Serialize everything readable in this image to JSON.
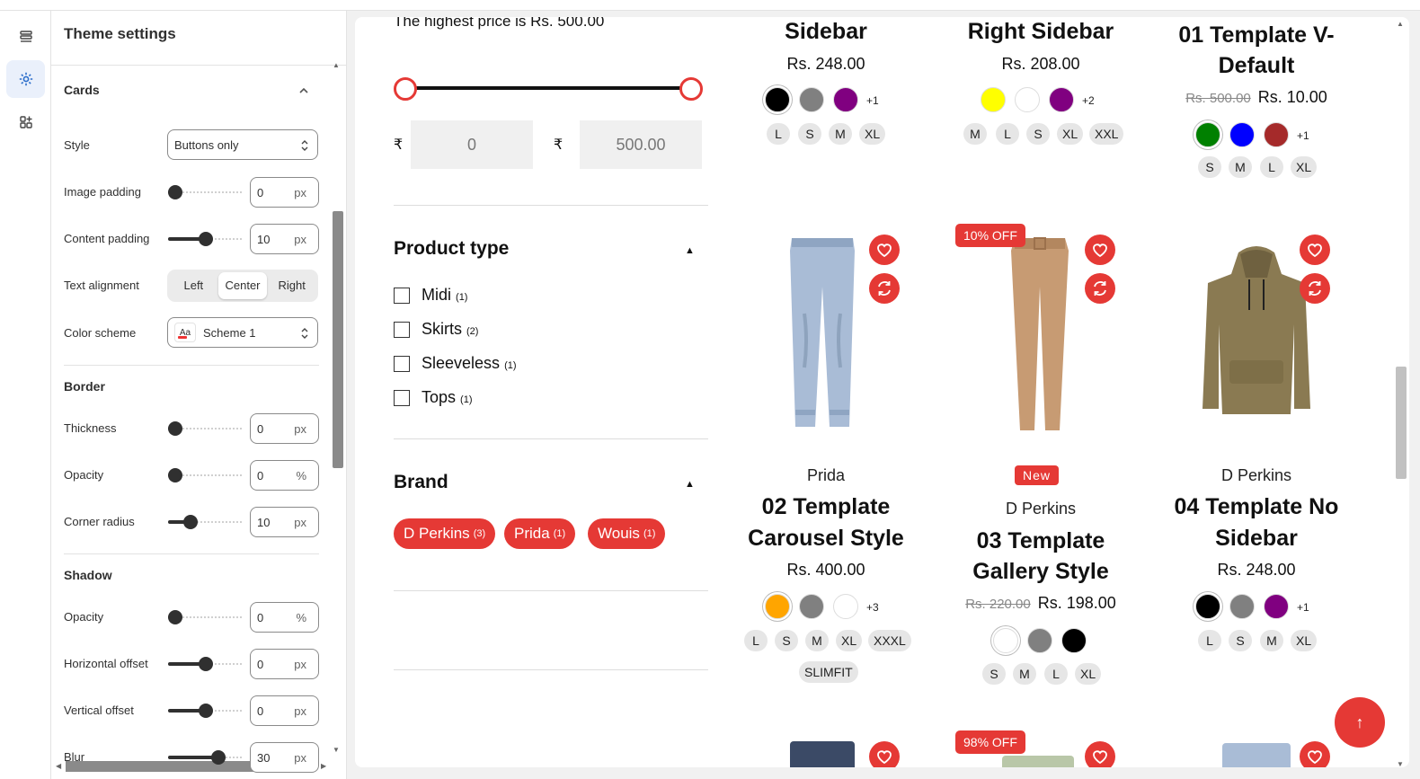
{
  "rail": {
    "icons": [
      "sections-icon",
      "gear-icon",
      "apps-icon"
    ]
  },
  "panel": {
    "title": "Theme settings",
    "cards": {
      "title": "Cards",
      "style_label": "Style",
      "style_value": "Buttons only",
      "image_padding_label": "Image padding",
      "image_padding_value": "0",
      "image_padding_unit": "px",
      "image_padding_level": 0,
      "content_padding_label": "Content padding",
      "content_padding_value": "10",
      "content_padding_unit": "px",
      "content_padding_level": 0.5,
      "text_alignment_label": "Text alignment",
      "align_options": [
        "Left",
        "Center",
        "Right"
      ],
      "align_selected": "Center",
      "color_scheme_label": "Color scheme",
      "color_scheme_swatch": "Aa",
      "color_scheme_value": "Scheme 1"
    },
    "border": {
      "title": "Border",
      "thickness_label": "Thickness",
      "thickness_value": "0",
      "thickness_unit": "px",
      "thickness_level": 0,
      "opacity_label": "Opacity",
      "opacity_value": "0",
      "opacity_unit": "%",
      "opacity_level": 0,
      "radius_label": "Corner radius",
      "radius_value": "10",
      "radius_unit": "px",
      "radius_level": 0.25
    },
    "shadow": {
      "title": "Shadow",
      "opacity_label": "Opacity",
      "opacity_value": "0",
      "opacity_unit": "%",
      "opacity_level": 0,
      "hoffset_label": "Horizontal offset",
      "hoffset_value": "0",
      "hoffset_unit": "px",
      "hoffset_level": 0.5,
      "voffset_label": "Vertical offset",
      "voffset_value": "0",
      "voffset_unit": "px",
      "voffset_level": 0.5,
      "blur_label": "Blur",
      "blur_value": "30",
      "blur_unit": "px",
      "blur_level": 0.7
    }
  },
  "filters": {
    "price_note": "The highest price is Rs. 500.00",
    "currency_symbol": "₹",
    "price_min": "0",
    "price_max": "500.00",
    "product_type": {
      "title": "Product type",
      "options": [
        {
          "label": "Midi",
          "count": "(1)"
        },
        {
          "label": "Skirts",
          "count": "(2)"
        },
        {
          "label": "Sleeveless",
          "count": "(1)"
        },
        {
          "label": "Tops",
          "count": "(1)"
        }
      ]
    },
    "brand": {
      "title": "Brand",
      "options": [
        {
          "label": "D Perkins",
          "count": "(3)"
        },
        {
          "label": "Prida",
          "count": "(1)"
        },
        {
          "label": "Wouis",
          "count": "(1)"
        }
      ]
    }
  },
  "products_top": [
    {
      "title": "Sidebar",
      "price": "Rs. 248.00",
      "colors": [
        "#000000",
        "#808080",
        "#800080"
      ],
      "more": "+1",
      "sizes": [
        "L",
        "S",
        "M",
        "XL"
      ]
    },
    {
      "title": "Right Sidebar",
      "price": "Rs. 208.00",
      "colors": [
        "#ffff00",
        "#ffffff",
        "#800080"
      ],
      "more": "+2",
      "sizes": [
        "M",
        "L",
        "S",
        "XL",
        "XXL"
      ]
    },
    {
      "title_line1": "01 Template V-",
      "title_line2": "Default",
      "compare_price": "Rs. 500.00",
      "price": "Rs. 10.00",
      "colors": [
        "#008000",
        "#0000ff",
        "#a52a2a"
      ],
      "more": "+1",
      "sizes": [
        "S",
        "M",
        "L",
        "XL"
      ]
    }
  ],
  "products_mid": [
    {
      "brand": "Prida",
      "title_line1": "02 Template",
      "title_line2": "Carousel Style",
      "price": "Rs. 400.00",
      "colors": [
        "#ffa500",
        "#808080",
        "#ffffff"
      ],
      "more": "+3",
      "sizes": [
        "L",
        "S",
        "M",
        "XL",
        "XXXL"
      ],
      "sizes2": [
        "SLIMFIT"
      ]
    },
    {
      "badge": "10% OFF",
      "new_badge": "New",
      "brand": "D Perkins",
      "title_line1": "03 Template",
      "title_line2": "Gallery Style",
      "compare_price": "Rs. 220.00",
      "price": "Rs. 198.00",
      "colors": [
        "#ffffff",
        "#808080",
        "#000000"
      ],
      "sizes": [
        "S",
        "M",
        "L",
        "XL"
      ]
    },
    {
      "brand": "D Perkins",
      "title_line1": "04 Template No",
      "title_line2": "Sidebar",
      "price": "Rs. 248.00",
      "colors": [
        "#000000",
        "#808080",
        "#800080"
      ],
      "more": "+1",
      "sizes": [
        "L",
        "S",
        "M",
        "XL"
      ]
    }
  ],
  "bottom_badge": "98% OFF",
  "colors": {
    "accent": "#e53935",
    "panel_accent": "#2c6ecb"
  }
}
